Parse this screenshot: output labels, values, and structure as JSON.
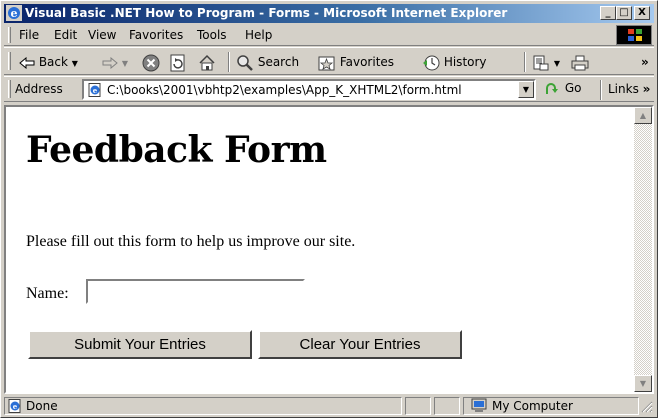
{
  "window": {
    "title": "Visual Basic .NET How to Program - Forms - Microsoft Internet Explorer",
    "controls": {
      "minimize": "_",
      "maximize": "□",
      "close": "X"
    }
  },
  "menubar": {
    "items": [
      {
        "label": "File"
      },
      {
        "label": "Edit"
      },
      {
        "label": "View"
      },
      {
        "label": "Favorites"
      },
      {
        "label": "Tools"
      },
      {
        "label": "Help"
      }
    ]
  },
  "toolbar": {
    "back_label": "Back",
    "search_label": "Search",
    "favorites_label": "Favorites",
    "history_label": "History",
    "overflow": "»"
  },
  "addressbar": {
    "label": "Address",
    "url": "C:\\books\\2001\\vbhtp2\\examples\\App_K_XHTML2\\form.html",
    "go_label": "Go",
    "links_label": "Links",
    "links_overflow": "»"
  },
  "page": {
    "heading": "Feedback Form",
    "intro": "Please fill out this form to help us improve our site.",
    "name_label": "Name:",
    "name_value": "",
    "submit_label": "Submit Your Entries",
    "clear_label": "Clear Your Entries"
  },
  "statusbar": {
    "status": "Done",
    "zone": "My Computer"
  },
  "colors": {
    "titlebar_start": "#0a246a",
    "titlebar_end": "#a6caf0",
    "chrome": "#d4d0c8"
  }
}
